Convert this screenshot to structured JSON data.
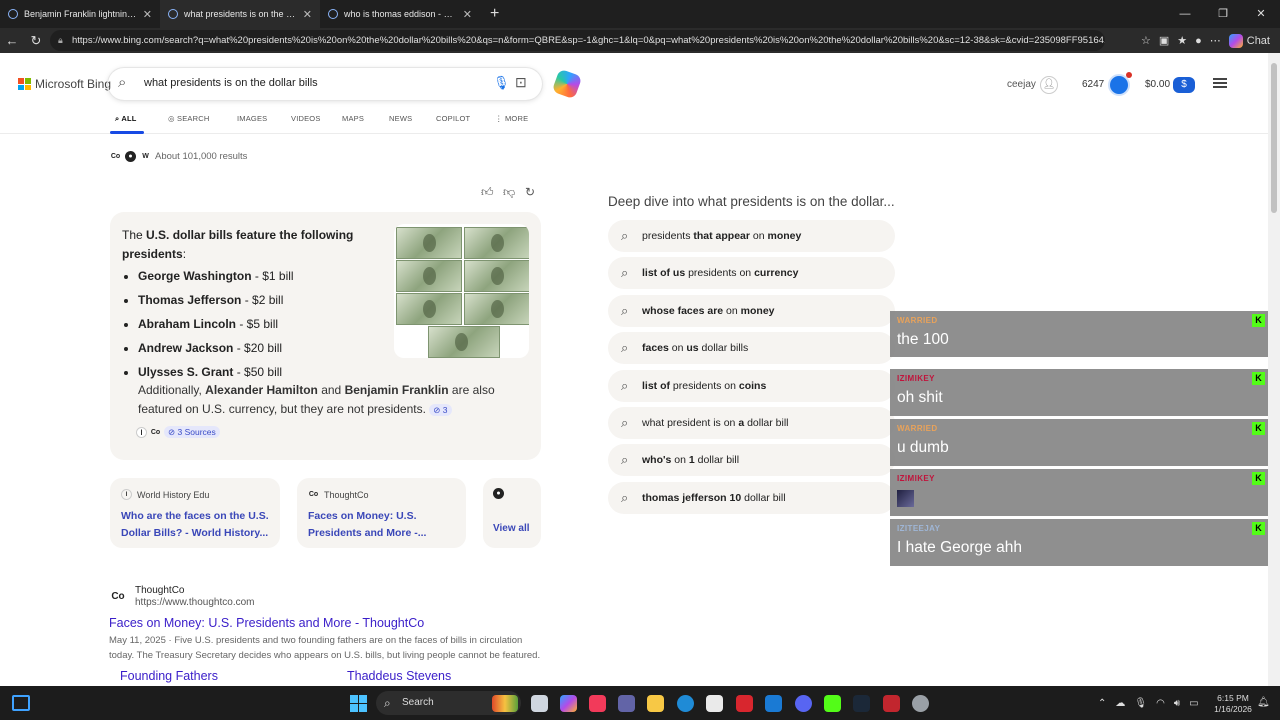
{
  "browser": {
    "tabs": [
      {
        "title": "Benjamin Franklin lightning kite - S",
        "active": false
      },
      {
        "title": "what presidents is on the dollar bi",
        "active": true
      },
      {
        "title": "who is thomas eddison - Search",
        "active": false
      }
    ],
    "url": "https://www.bing.com/search?q=what%20presidents%20is%20on%20the%20dollar%20bills%20&qs=n&form=QBRE&sp=-1&ghc=1&lq=0&pq=what%20presidents%20is%20on%20the%20dollar%20bills%20&sc=12-38&sk=&cvid=235098FF95164...",
    "chat_label": "Chat"
  },
  "header": {
    "brand": "Microsoft Bing",
    "query": "what presidents is on the dollar bills",
    "username": "ceejay",
    "points": "6247",
    "balance": "$0.00",
    "money_symbol": "$"
  },
  "search_tabs": [
    "ALL",
    "SEARCH",
    "IMAGES",
    "VIDEOS",
    "MAPS",
    "NEWS",
    "COPILOT",
    "MORE"
  ],
  "results_count": "About 101,000 results",
  "answer": {
    "intro_pre": "The ",
    "intro_bold": "U.S. dollar bills feature the following presidents",
    "intro_post": ":",
    "items": [
      {
        "name": "George Washington",
        "value": " - $1 bill"
      },
      {
        "name": "Thomas Jefferson",
        "value": " - $2 bill"
      },
      {
        "name": "Abraham Lincoln",
        "value": " - $5 bill"
      },
      {
        "name": "Andrew Jackson",
        "value": " - $20 bill"
      },
      {
        "name": "Ulysses S. Grant",
        "value": " - $50 bill"
      }
    ],
    "extra_1": "Additionally, ",
    "extra_bold_1": "Alexander Hamilton",
    "extra_2": " and ",
    "extra_bold_2": "Benjamin Franklin",
    "extra_3": " are also featured on U.S. currency, but they are not presidents.",
    "cite_count": "3",
    "sources_label": "3 Sources"
  },
  "source_cards": [
    {
      "site": "World History Edu",
      "title": "Who are the faces on the U.S. Dollar Bills? - World History..."
    },
    {
      "site": "ThoughtCo",
      "title": "Faces on Money: U.S. Presidents and More -..."
    }
  ],
  "view_all": "View all",
  "organic": {
    "site_name": "ThoughtCo",
    "site_url": "https://www.thoughtco.com",
    "title": "Faces on Money: U.S. Presidents and More - ThoughtCo",
    "date": "May 11, 2025",
    "snippet": " · Five U.S. presidents and two founding fathers are on the faces of bills in circulation today. The Treasury Secretary decides who appears on U.S. bills, but living people cannot be featured.",
    "links": [
      "Founding Fathers",
      "Thaddeus Stevens"
    ]
  },
  "deep_dive": {
    "title": "Deep dive into what presidents is on the dollar...",
    "items": [
      [
        {
          "t": "presidents ",
          "b": false
        },
        {
          "t": "that appear",
          "b": true
        },
        {
          "t": " on ",
          "b": false
        },
        {
          "t": "money",
          "b": true
        }
      ],
      [
        {
          "t": "list of us",
          "b": true
        },
        {
          "t": " presidents on ",
          "b": false
        },
        {
          "t": "currency",
          "b": true
        }
      ],
      [
        {
          "t": "whose faces are",
          "b": true
        },
        {
          "t": " on ",
          "b": false
        },
        {
          "t": "money",
          "b": true
        }
      ],
      [
        {
          "t": "faces",
          "b": true
        },
        {
          "t": " on ",
          "b": false
        },
        {
          "t": "us",
          "b": true
        },
        {
          "t": " dollar bills",
          "b": false
        }
      ],
      [
        {
          "t": "list of",
          "b": true
        },
        {
          "t": " presidents on ",
          "b": false
        },
        {
          "t": "coins",
          "b": true
        }
      ],
      [
        {
          "t": "what president is on ",
          "b": false
        },
        {
          "t": "a",
          "b": true
        },
        {
          "t": " dollar bill",
          "b": false
        }
      ],
      [
        {
          "t": "who's",
          "b": true
        },
        {
          "t": " on ",
          "b": false
        },
        {
          "t": "1",
          "b": true
        },
        {
          "t": " dollar bill",
          "b": false
        }
      ],
      [
        {
          "t": "thomas jefferson 10",
          "b": true
        },
        {
          "t": " dollar bill",
          "b": false
        }
      ]
    ]
  },
  "chat_overlay": [
    {
      "user": "WARRIED",
      "text": "the 100",
      "user_color": "#e8a25a",
      "kick": "K"
    },
    {
      "user": "IZIMIKEY",
      "text": "oh shit",
      "user_color": "#c0143c",
      "kick": "K"
    },
    {
      "user": "WARRIED",
      "text": "u dumb",
      "user_color": "#e8a25a",
      "kick": "K"
    },
    {
      "user": "IZIMIKEY",
      "text": "",
      "user_color": "#c0143c",
      "kick": "K"
    },
    {
      "user": "IZITEEJAY",
      "text": "I hate George ahh",
      "user_color": "#9fb6d6",
      "kick": "K"
    }
  ],
  "taskbar": {
    "search_label": "Search",
    "time": "6:15 PM",
    "date": "1/16/2026"
  },
  "colors": {
    "accent": "#174ae4",
    "link": "#3a47b8",
    "kick_green": "#53fc18"
  }
}
